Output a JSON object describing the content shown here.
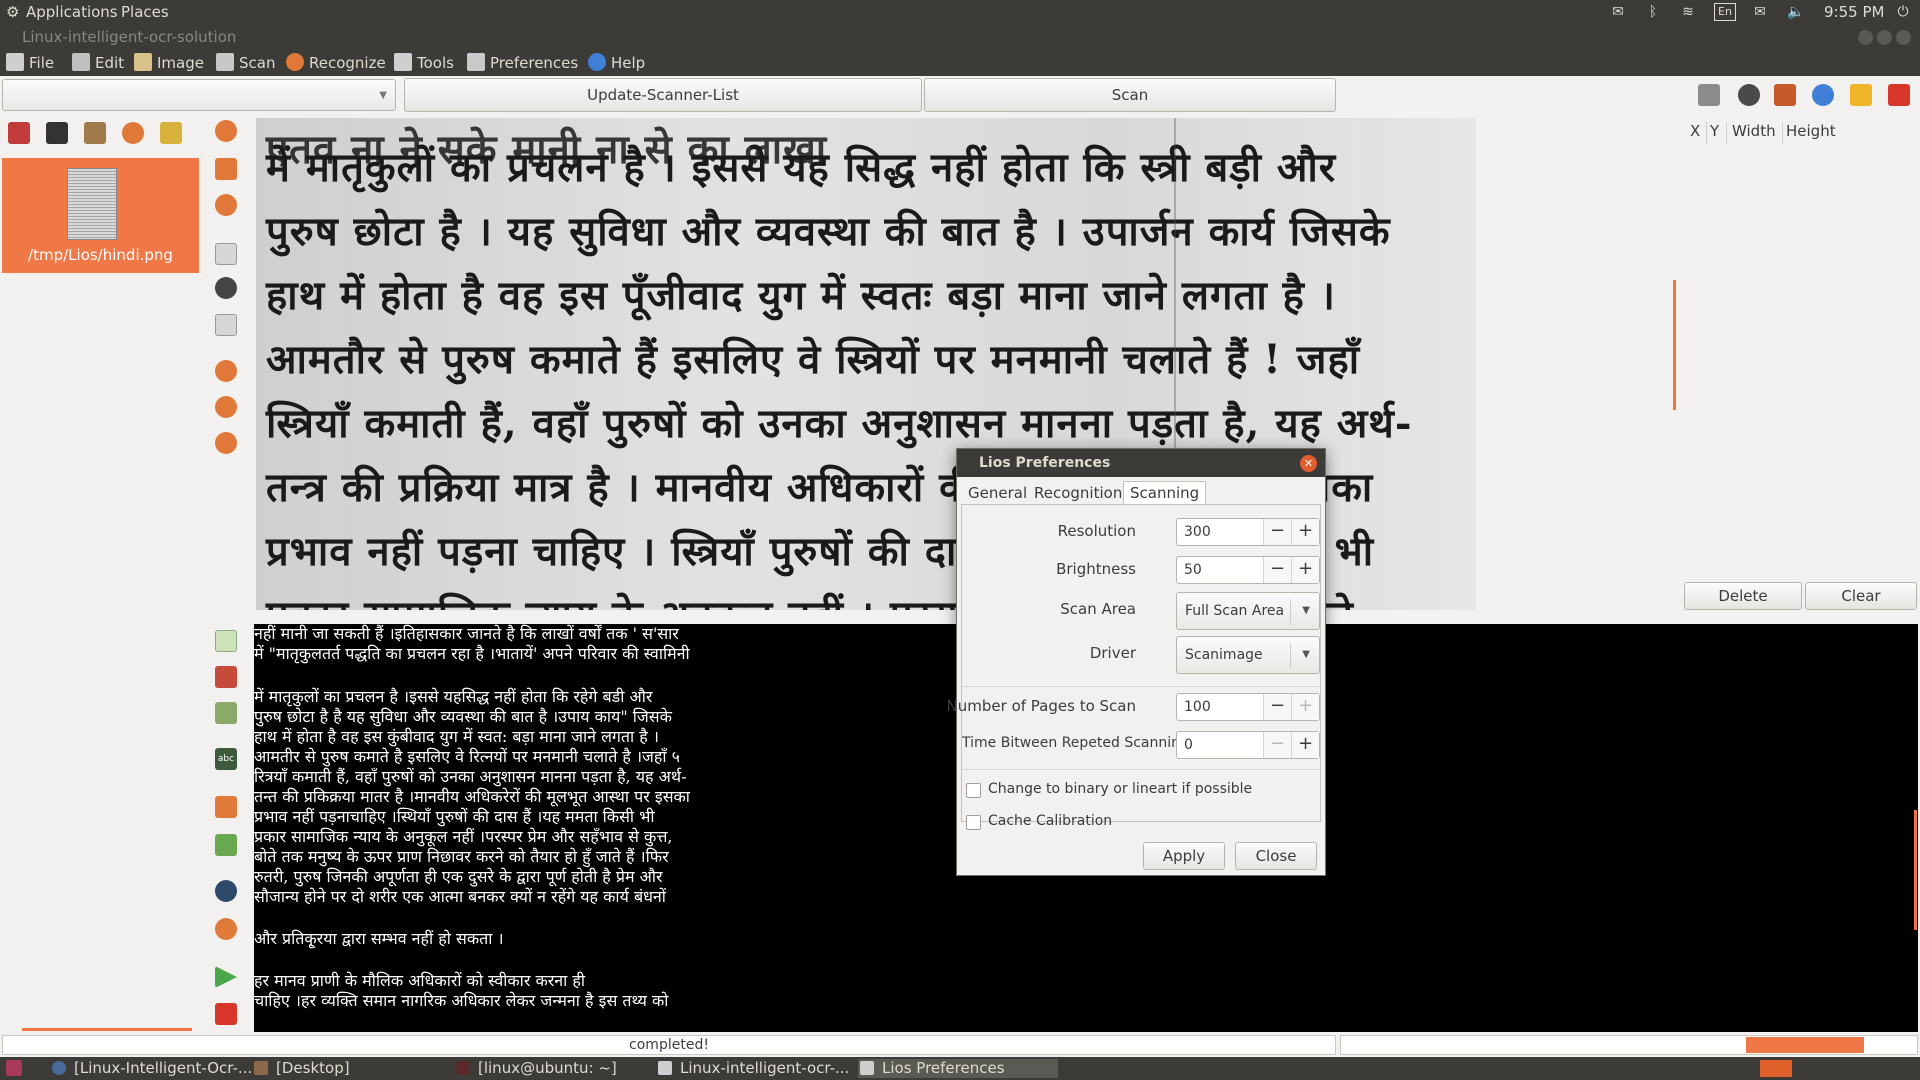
{
  "top_panel": {
    "applications": "Applications",
    "places": "Places",
    "keyboard_layout": "En",
    "clock": "9:55 PM"
  },
  "window": {
    "title": "Linux-intelligent-ocr-solution"
  },
  "menubar": {
    "items": [
      {
        "label": "File",
        "icon": "file-icon"
      },
      {
        "label": "Edit",
        "icon": "scissors-icon"
      },
      {
        "label": "Image",
        "icon": "image-icon"
      },
      {
        "label": "Scan",
        "icon": "scanner-icon"
      },
      {
        "label": "Recognize",
        "icon": "recognize-icon"
      },
      {
        "label": "Tools",
        "icon": "tools-icon"
      },
      {
        "label": "Preferences",
        "icon": "preferences-icon"
      },
      {
        "label": "Help",
        "icon": "help-icon"
      }
    ]
  },
  "toolbar": {
    "scanner_combo_value": "",
    "update_scanner_list": "Update-Scanner-List",
    "scan": "Scan"
  },
  "image_list": {
    "items": [
      {
        "label": "/tmp/Lios/hindi.png"
      }
    ]
  },
  "scan_image": {
    "lines": [
      "में मातृकुलों का प्रचलन है । इससे यह सिद्ध नहीं होता कि स्त्री   बड़ी और",
      "पुरुष छोटा है । यह सुविधा और व्यवस्था की बात है । उपार्जन कार्य जिसके",
      "हाथ में होता है वह इस पूँजीवाद युग में स्वतः बड़ा माना जाने लगता है ।",
      "आमतौर से पुरुष कमाते हैं इसलिए वे स्त्रियों पर मनमानी चलाते हैं ! जहाँ",
      "स्त्रियाँ कमाती हैं, वहाँ पुरुषों को उनका अनुशासन मानना पड़ता है, यह अर्थ-",
      "तन्त्र की प्रक्रिया मात्र है । मानवीय अधिकारों की मूलभूत आस्था पर इसका",
      "प्रभाव नहीं पड़ना चाहिए । स्त्रियाँ पुरुषों की दासी हैं । यह ममता किसी भी",
      "प्रकार सामाजिक न्याय के अनुकूल नहीं । परस्पर प्रेम और सद्भाव से कुत्ते,"
    ]
  },
  "ocr_text": {
    "lines": [
      "नहीं मानी जा सकती हैं ।इतिहासकार जानते है कि लाखों वर्षों तक ' स'सार",
      "में \"मातृकुलतर्त पद्धति का प्रचलन रहा है ।भातायें' अपने परिवार की स्वामिनी",
      "",
      "में मातृकुलों का प्रचलन है ।इससे यहसिद्ध नहीं होता कि रहेगे बडी और",
      "पुरुष छोटा है है यह सुविधा और व्यवस्था की बात है ।उपाय काय\" जिसके",
      "हाथ में होता है वह इस कुंबीवाद युग में स्वत: बड़ा माना जाने लगता है ।",
      "आमतीर से पुरुष कमाते है इसलिए वे रित्नयों पर मनमानी चलाते है ।जहाँ ५",
      "रित्रयाँ कमाती हैं, वहाँ पुरुषों को उनका अनुशासन मानना पड़ता है, यह अर्थ-",
      "तन्त की प्रकिक्रया मातर है ।मानवीय अधिकरेरों की मूलभूत आस्था पर इसका",
      "प्रभाव नहीं पड़नाचाहिए ।स्थियाँ पुरुषों की दास हैं ।यह ममता किसी भी",
      "प्रकार सामाजिक न्याय के अनुकूल नहीं ।परस्पर प्रेम और सहँभाव से कुत्त,",
      "बोते तक मनुष्य के ऊपर प्राण निछावर करने को तैयार हो हुँ जाते हैं ।फिर",
      "रुतरी, पुरुष जिनकी अपूर्णता ही एक दुसरे के द्वारा पूर्ण होती है प्रेम और",
      "सौजान्य होने पर दो शरीर एक आत्मा बनकर क्यों न रहेंगे  यह कार्य बंधनों",
      "",
      "और प्रतिकृ्रया द्वारा सम्भव नहीं हो सकता ।",
      "",
      " हर मानव प्राणी के मौलिक अधिकारों को स्वीकार करना ही",
      "चाहिए ।हर व्यक्ति समान नागरिक अधिकार लेकर जन्मना है इस तथ्य को"
    ]
  },
  "region_table": {
    "headers": [
      "X",
      "Y",
      "Width",
      "Height"
    ],
    "delete": "Delete",
    "clear": "Clear"
  },
  "status": {
    "text": "completed!",
    "progress_fraction": 0.2
  },
  "taskbar": {
    "items": [
      "[Linux-Intelligent-Ocr-...",
      "[Desktop]",
      "[linux@ubuntu: ~]",
      "Linux-intelligent-ocr-...",
      "Lios Preferences"
    ]
  },
  "dialog": {
    "title": "Lios Preferences",
    "tabs": [
      "General",
      "Recognition",
      "Scanning"
    ],
    "active_tab": "Scanning",
    "fields": {
      "resolution": {
        "label": "Resolution",
        "value": "300"
      },
      "brightness": {
        "label": "Brightness",
        "value": "50"
      },
      "scan_area": {
        "label": "Scan Area",
        "value": "Full Scan Area"
      },
      "driver": {
        "label": "Driver",
        "value": "Scanimage"
      },
      "pages": {
        "label": "Number of Pages to Scan",
        "value": "100"
      },
      "time_between": {
        "label": "Time Bitween Repeted Scanning",
        "value": "0"
      }
    },
    "checkboxes": [
      {
        "label": "Change to binary or lineart if possible",
        "checked": false
      },
      {
        "label": "Cache Calibration",
        "checked": false
      }
    ],
    "apply": "Apply",
    "close": "Close"
  },
  "colors": {
    "accent": "#f07746",
    "panel": "#3c3b37",
    "window_bg": "#f2f1f0"
  }
}
